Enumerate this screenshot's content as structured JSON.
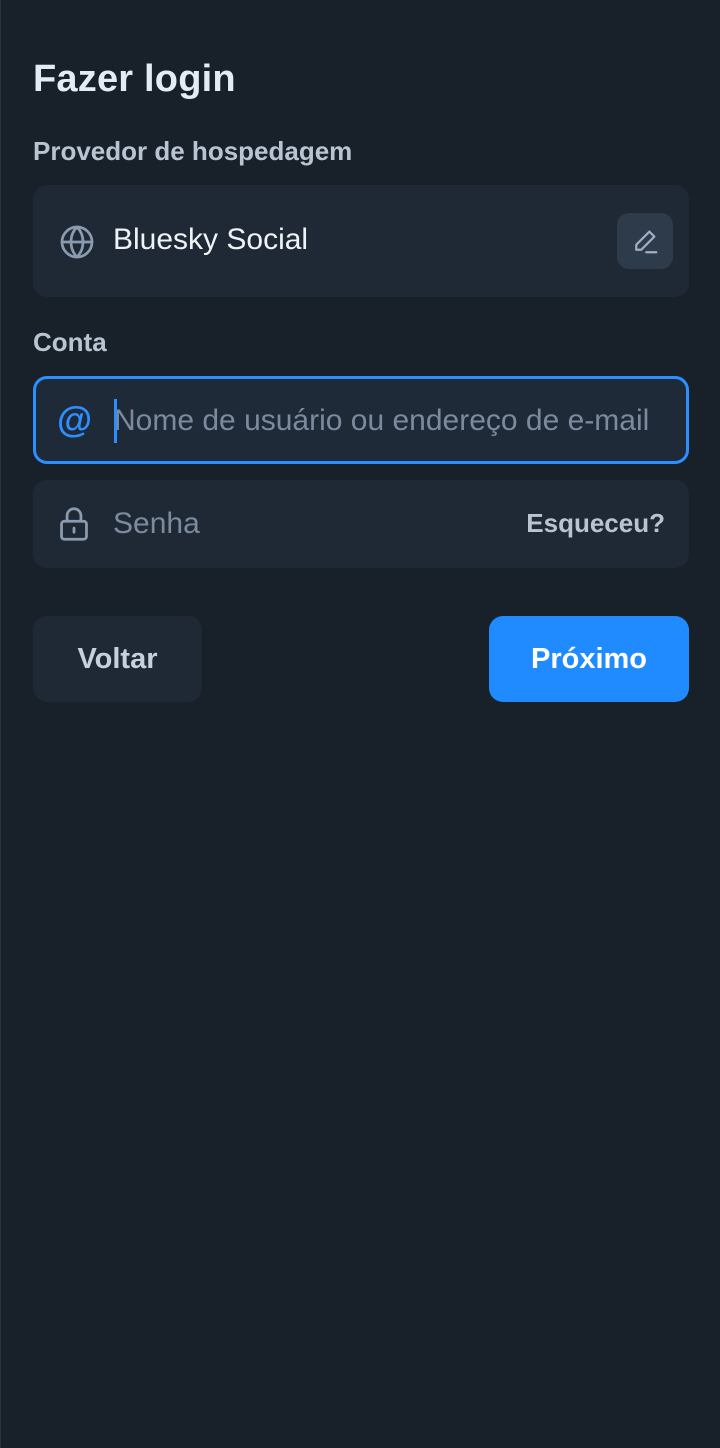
{
  "page": {
    "title": "Fazer login"
  },
  "provider": {
    "label": "Provedor de hospedagem",
    "name": "Bluesky Social",
    "icon": "globe-icon",
    "edit_icon": "pencil-icon"
  },
  "account": {
    "label": "Conta",
    "username": {
      "icon": "at-icon",
      "icon_glyph": "@",
      "value": "",
      "placeholder": "Nome de usuário ou endereço de e-mail"
    },
    "password": {
      "icon": "lock-icon",
      "value": "",
      "placeholder": "Senha",
      "forgot_label": "Esqueceu?"
    }
  },
  "actions": {
    "back_label": "Voltar",
    "next_label": "Próximo"
  },
  "colors": {
    "background": "#18202a",
    "surface": "#1f2935",
    "accent": "#208bfe",
    "focus_border": "#2d8fff",
    "muted_text": "#b8c4d2",
    "placeholder": "#7b8b9d"
  }
}
